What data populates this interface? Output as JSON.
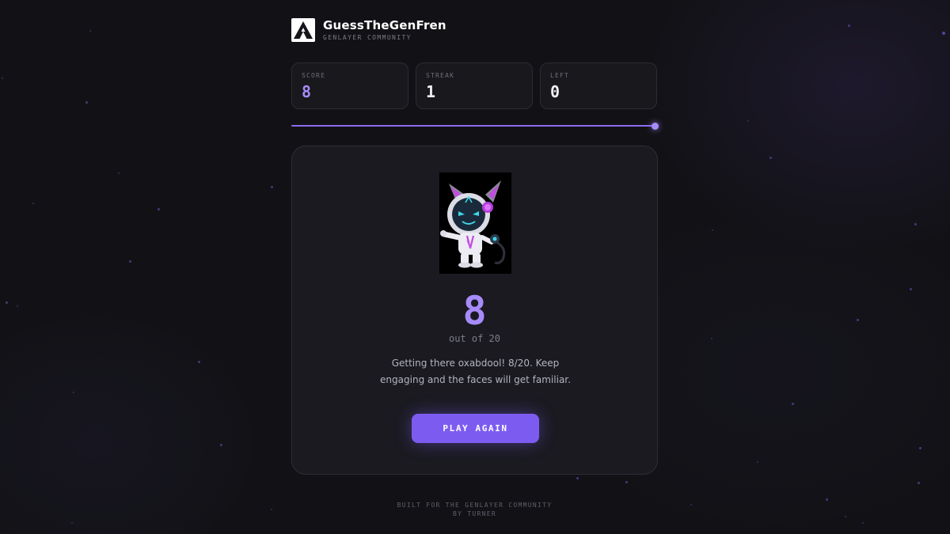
{
  "brand": {
    "title": "GuessTheGenFren",
    "subtitle": "GENLAYER COMMUNITY"
  },
  "stats": [
    {
      "label": "SCORE",
      "value": "8"
    },
    {
      "label": "STREAK",
      "value": "1"
    },
    {
      "label": "LEFT",
      "value": "0"
    }
  ],
  "progress": {
    "fraction": 1.0
  },
  "result": {
    "score": "8",
    "out_of": "out of 20",
    "message": "Getting there oxabdool! 8/20. Keep engaging and the faces will get familiar.",
    "play_again_label": "PLAY AGAIN"
  },
  "footer": {
    "line1": "BUILT FOR THE GENLAYER COMMUNITY",
    "line2": "BY TURNER"
  },
  "colors": {
    "accent": "#a78bfa",
    "button": "#7c5cf0",
    "background": "#121216",
    "card": "#1a1a20"
  },
  "icons": {
    "logo": "genlayer-triangle-logo"
  }
}
